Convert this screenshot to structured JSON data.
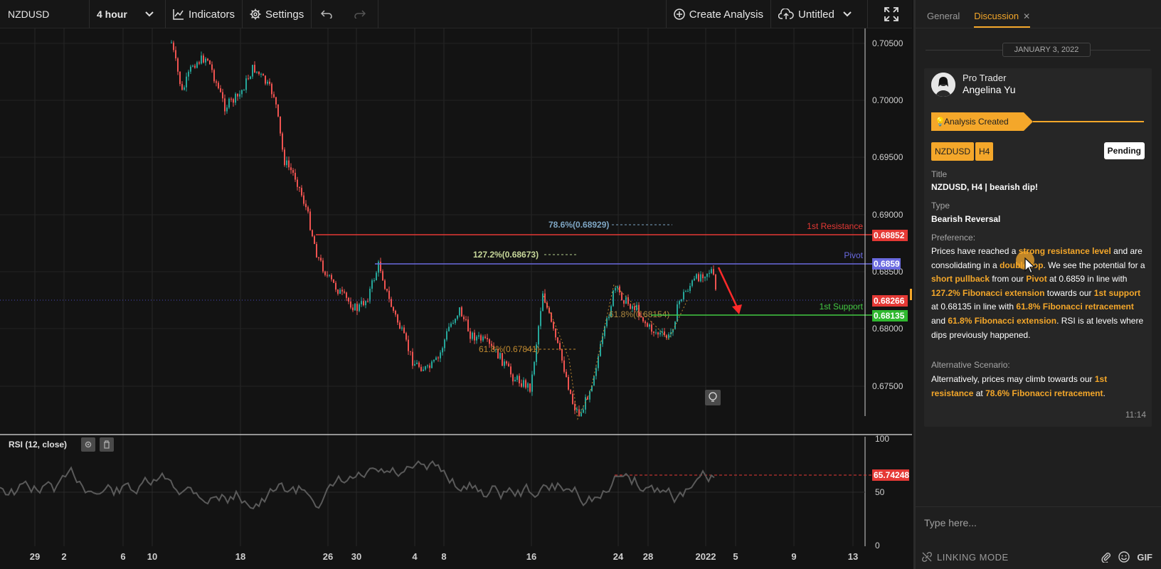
{
  "toolbar": {
    "symbol": "NZDUSD",
    "interval": "4 hour",
    "indicators_label": "Indicators",
    "settings_label": "Settings",
    "create_analysis_label": "Create Analysis",
    "layout_name": "Untitled"
  },
  "chart": {
    "price_axis": [
      "0.70500",
      "0.70000",
      "0.69500",
      "0.69000",
      "0.68500",
      "0.68000",
      "0.67500"
    ],
    "date_axis": [
      "29",
      "2",
      "6",
      "10",
      "18",
      "26",
      "30",
      "4",
      "8",
      "16",
      "24",
      "28",
      "2022",
      "5",
      "9",
      "13"
    ],
    "levels": {
      "resistance": {
        "label": "1st Resistance",
        "value": "0.68852",
        "color": "#e53935"
      },
      "pivot": {
        "label": "Pivot",
        "value": "0.6859",
        "color": "#6a6ae0"
      },
      "current": {
        "value": "0.68266",
        "color": "#e53935"
      },
      "support": {
        "label": "1st Support",
        "value": "0.68135",
        "color": "#43c943"
      }
    },
    "fib_labels": {
      "retr_786": "78.6%(0.68929)",
      "ext_1272": "127.2%(0.68673)",
      "retr_618": "61.8%(0.67841)",
      "ext_618": "61.8%(0.68154)"
    },
    "colors": {
      "up": "#26a69a",
      "down": "#ef5350",
      "accent": "#f4a72a"
    }
  },
  "rsi": {
    "title": "RSI (12, close)",
    "axis": [
      "100",
      "50",
      "0"
    ],
    "level_value": "65.74248"
  },
  "panel": {
    "tabs": {
      "general": "General",
      "discussion": "Discussion"
    },
    "date_separator": "JANUARY 3, 2022",
    "author": {
      "role": "Pro Trader",
      "name": "Angelina Yu"
    },
    "badge": "Analysis Created",
    "tags": [
      "NZDUSD",
      "H4"
    ],
    "status": "Pending",
    "title_label": "Title",
    "title_value": "NZDUSD, H4 | bearish dip!",
    "type_label": "Type",
    "type_value": "Bearish Reversal",
    "preference_label": "Preference:",
    "preference": {
      "t1": "Prices have reached a ",
      "h1": "strong resistance level",
      "t2": " and are consolidating in a ",
      "h2": "double top",
      "t3": ". We see the potential for a ",
      "h3": "short pullback",
      "t4": " from our ",
      "h4": "Pivot",
      "t5": " at 0.6859 in line with ",
      "h5": "127.2% Fibonacci extension",
      "t6": " towards our ",
      "h6": "1st support",
      "t7": " at 0.68135 in line with ",
      "h7": "61.8% Fibonacci retracement",
      "t8": " and ",
      "h8": "61.8% Fibonacci extension",
      "t9": ". RSI is at levels where dips previously happened."
    },
    "alt_label": "Alternative Scenario:",
    "alternative": {
      "t1": "Alternatively, prices may climb towards our ",
      "h1": "1st resistance",
      "t2": " at ",
      "h2": "78.6% Fibonacci retracement",
      "t3": "."
    },
    "message_time": "11:14",
    "composer_placeholder": "Type here...",
    "linking_label": "LINKING MODE",
    "gif_label": "GIF"
  }
}
